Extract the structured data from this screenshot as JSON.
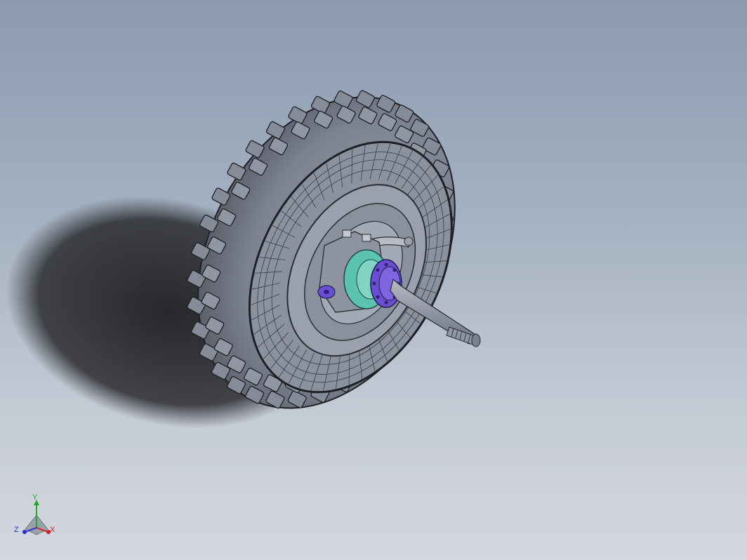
{
  "viewport": {
    "background_top": "#8c9aaf",
    "background_bottom": "#d3d7df",
    "model": "wheel-assembly",
    "colors": {
      "tire": "#7d8290",
      "tire_lines": "#1e2028",
      "shadow": "#1f2022",
      "hub_purple": "#6a4fd0",
      "bearing_teal": "#5cc3b0",
      "shaft": "#8f96a4"
    }
  },
  "triad": {
    "x_label": "X",
    "y_label": "Y",
    "z_label": "Z",
    "x_color": "#cc2222",
    "y_color": "#22aa22",
    "z_color": "#2233cc"
  }
}
